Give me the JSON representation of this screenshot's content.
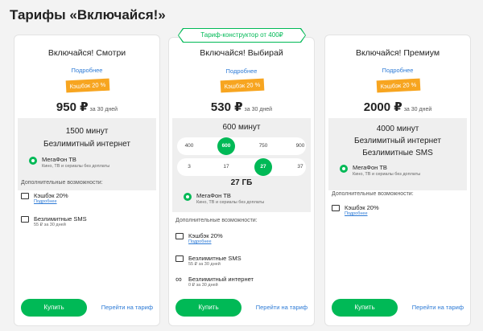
{
  "page": {
    "title": "Тарифы «Включайся!»"
  },
  "ribbon": {
    "label": "Тариф-конструктор от 400₽"
  },
  "cards": [
    {
      "name": "Включайся! Смотри",
      "more": "Подробнее",
      "cashback": "Кэшбэк 20 %",
      "price": "950 ₽",
      "per": "за 30 дней",
      "minutes": "1500 минут",
      "internet": "Безлимитный интернет",
      "tv_title": "МегаФон ТВ",
      "tv_sub": "Кино, ТВ и сериалы без доплаты",
      "extras_title": "Дополнительные возможности:",
      "extras": [
        {
          "title": "Кэшбэк 20%",
          "sub": "Подробнее"
        },
        {
          "title": "Безлимитные SMS",
          "sub": "55 ₽ за 30 дней"
        }
      ],
      "buy": "Купить",
      "goto": "Перейти на тариф"
    },
    {
      "name": "Включайся! Выбирай",
      "more": "Подробнее",
      "cashback": "Кэшбэк 20 %",
      "price": "530 ₽",
      "per": "за 30 дней",
      "minutes": "600 минут",
      "minute_options": [
        "400",
        "600",
        "750",
        "900"
      ],
      "minute_selected": "600",
      "gb_options": [
        "3",
        "17",
        "27",
        "37"
      ],
      "gb_selected": "27",
      "gb": "27 ГБ",
      "tv_title": "МегаФон ТВ",
      "tv_sub": "Кино, ТВ и сериалы без доплаты",
      "extras_title": "Дополнительные возможности:",
      "extras": [
        {
          "title": "Кэшбэк 20%",
          "sub": "Подробнее"
        },
        {
          "title": "Безлимитные SMS",
          "sub": "55 ₽ за 30 дней"
        },
        {
          "title": "Безлимитный интернет",
          "sub": "0 ₽ за 30 дней"
        }
      ],
      "buy": "Купить",
      "goto": "Перейти на тариф"
    },
    {
      "name": "Включайся! Премиум",
      "more": "Подробнее",
      "cashback": "Кэшбэк 20 %",
      "price": "2000 ₽",
      "per": "за 30 дней",
      "minutes": "4000 минут",
      "internet": "Безлимитный интернет",
      "sms": "Безлимитные SMS",
      "tv_title": "МегаФон ТВ",
      "tv_sub": "Кино, ТВ и сериалы без доплаты",
      "extras_title": "Дополнительные возможности:",
      "extras": [
        {
          "title": "Кэшбэк 20%",
          "sub": "Подробнее"
        }
      ],
      "buy": "Купить",
      "goto": "Перейти на тариф"
    }
  ],
  "colors": {
    "accent": "#00b956",
    "cashback": "#f7a520",
    "link": "#2e7bd6"
  }
}
